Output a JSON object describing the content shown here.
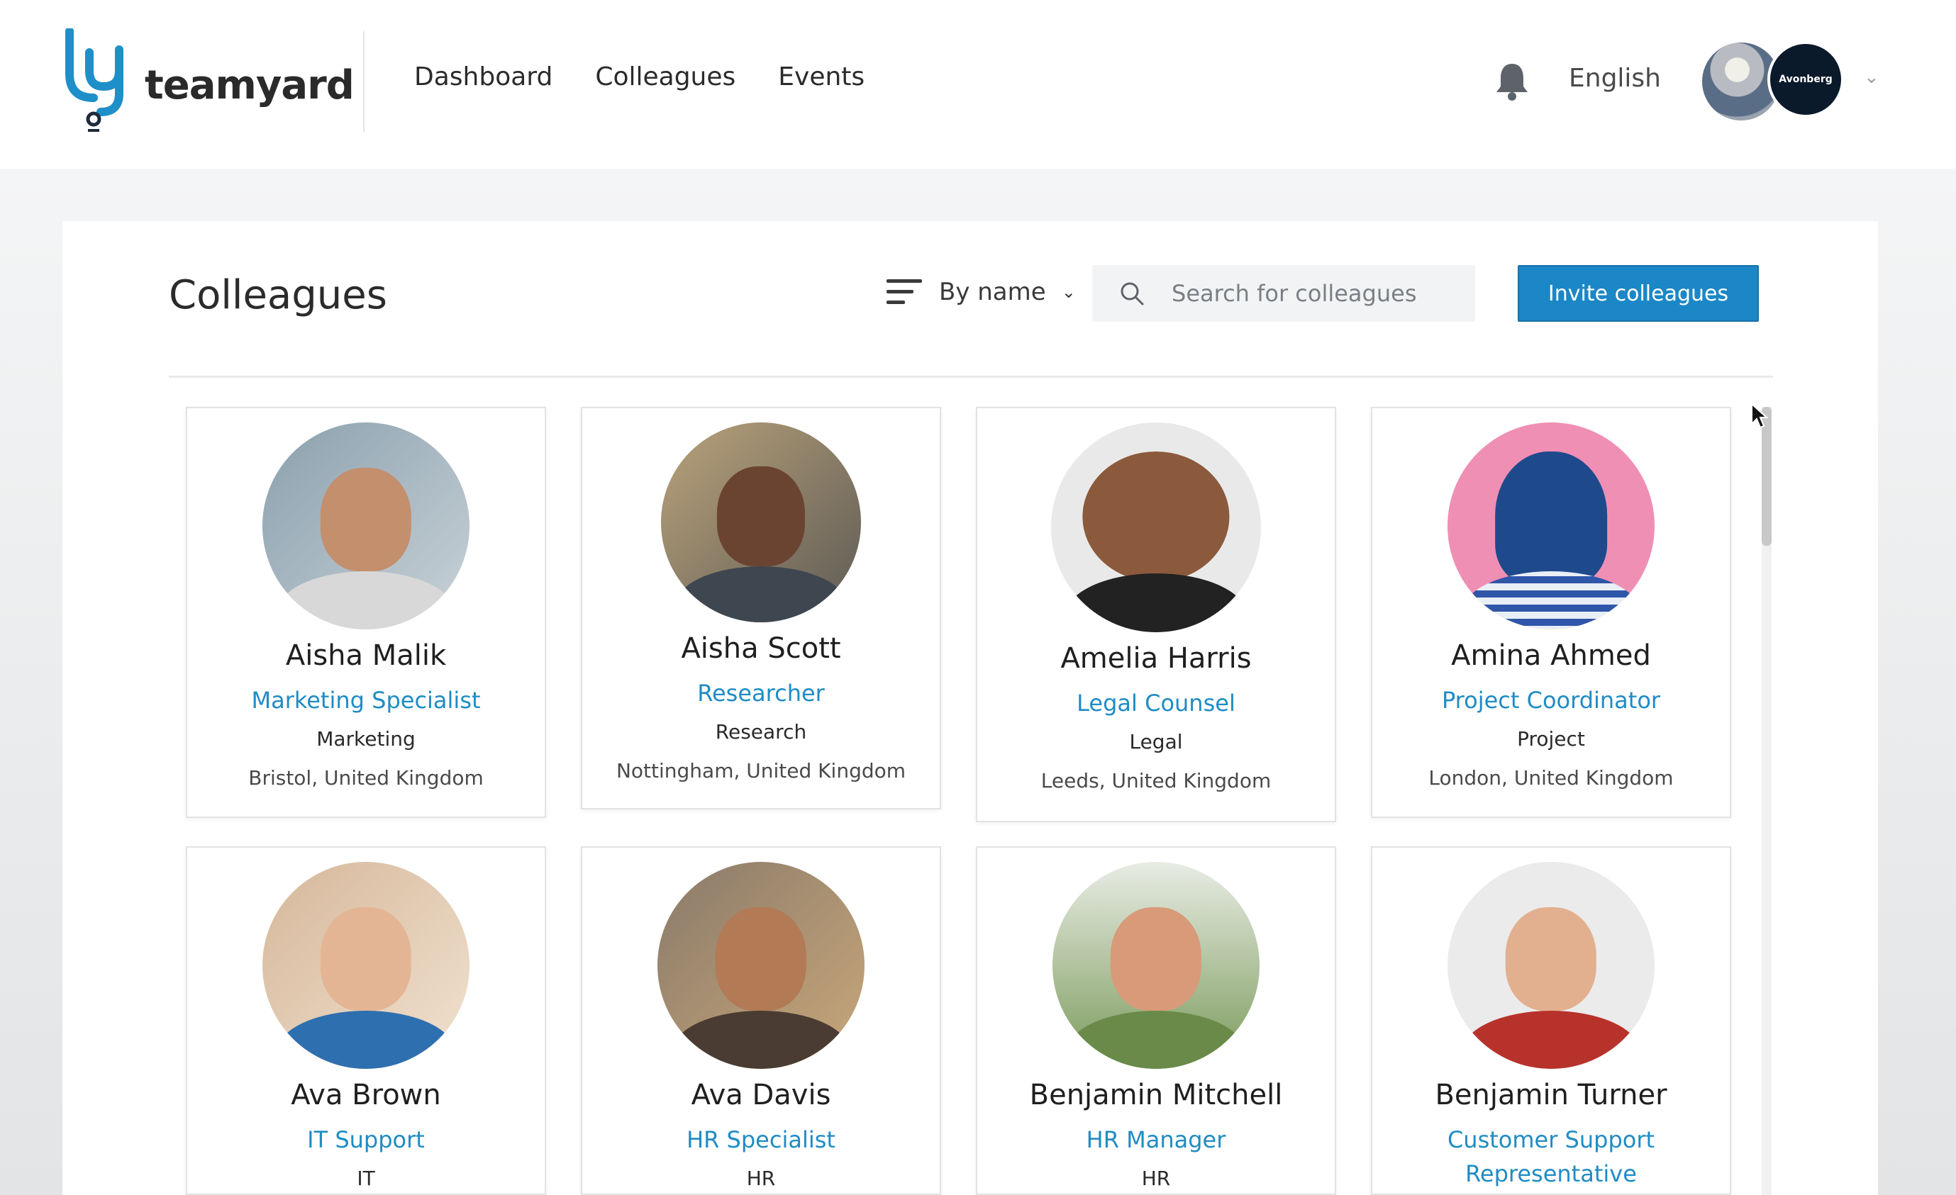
{
  "header": {
    "brand": "teamyard",
    "nav": [
      "Dashboard",
      "Colleagues",
      "Events"
    ],
    "language": "English",
    "org_badge": "Avonberg"
  },
  "main": {
    "title": "Colleagues",
    "sort_label": "By name",
    "search_placeholder": "Search for colleagues",
    "invite_label": "Invite colleagues"
  },
  "colleagues": [
    {
      "name": "Aisha Malik",
      "role": "Marketing Specialist",
      "department": "Marketing",
      "location": "Bristol, United Kingdom"
    },
    {
      "name": "Aisha Scott",
      "role": "Researcher",
      "department": "Research",
      "location": "Nottingham, United Kingdom"
    },
    {
      "name": "Amelia Harris",
      "role": "Legal Counsel",
      "department": "Legal",
      "location": "Leeds, United Kingdom"
    },
    {
      "name": "Amina Ahmed",
      "role": "Project Coordinator",
      "department": "Project",
      "location": "London, United Kingdom"
    },
    {
      "name": "Ava Brown",
      "role": "IT Support",
      "department": "IT",
      "location": ""
    },
    {
      "name": "Ava Davis",
      "role": "HR Specialist",
      "department": "HR",
      "location": ""
    },
    {
      "name": "Benjamin Mitchell",
      "role": "HR Manager",
      "department": "HR",
      "location": ""
    },
    {
      "name": "Benjamin Turner",
      "role": "Customer Support Representative",
      "department": "",
      "location": ""
    }
  ],
  "colors": {
    "accent": "#1b87c6",
    "role_text": "#1f8cc4",
    "logo_blue": "#1e8fc9"
  },
  "icons": [
    "logo-icon",
    "bell-icon",
    "sort-icon",
    "search-icon",
    "chevron-down-icon",
    "cursor-icon"
  ]
}
